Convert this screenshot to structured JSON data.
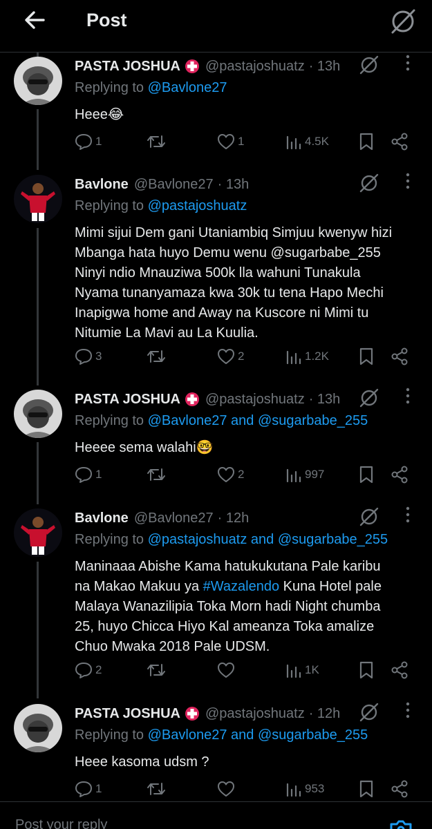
{
  "header": {
    "title": "Post"
  },
  "replies": [
    {
      "name": "PASTA JOSHUA",
      "handle": "@pastajoshuatz",
      "time": "· 13h",
      "replying_prefix": "Replying to ",
      "mentions": [
        "@Bavlone27"
      ],
      "text": "Heee😂",
      "stats": {
        "replies": "1",
        "reposts": "",
        "likes": "1",
        "views": "4.5K"
      }
    },
    {
      "name": "Bavlone",
      "handle": "@Bavlone27",
      "time": "· 13h",
      "replying_prefix": "Replying to ",
      "mentions": [
        "@pastajoshuatz"
      ],
      "text": "Mimi sijui Dem gani Utaniambiq Simjuu kwenyw hizi\nMbanga hata huyo Demu wenu @sugarbabe_255\nNinyi ndio Mnauziwa 500k lla wahuni Tunakula\nNyama tunanyamaza kwa 30k tu tena Hapo Mechi\nInapigwa home and Away na Kuscore ni Mimi tu\nNitumie La Mavi au La Kuulia.",
      "stats": {
        "replies": "3",
        "reposts": "",
        "likes": "2",
        "views": "1.2K"
      }
    },
    {
      "name": "PASTA JOSHUA",
      "handle": "@pastajoshuatz",
      "time": "· 13h",
      "replying_prefix": "Replying to ",
      "mentions": [
        "@Bavlone27",
        "@sugarbabe_255"
      ],
      "conj": " and ",
      "text": "Heeee sema walahi🤓",
      "stats": {
        "replies": "1",
        "reposts": "",
        "likes": "2",
        "views": "997"
      }
    },
    {
      "name": "Bavlone",
      "handle": "@Bavlone27",
      "time": "· 12h",
      "replying_prefix": "Replying to ",
      "mentions": [
        "@pastajoshuatz",
        "@sugarbabe_255"
      ],
      "conj": " and ",
      "text_parts": [
        "Maninaaa Abishe Kama hatukukutana Pale karibu\nna Makao Makuu ya ",
        "#Wazalendo",
        " Kuna Hotel pale\nMalaya Wanazilipia Toka Morn hadi Night chumba\n25, huyo Chicca Hiyo Kal ameanza Toka amalize\nChuo Mwaka 2018 Pale UDSM."
      ],
      "stats": {
        "replies": "2",
        "reposts": "",
        "likes": "",
        "views": "1K"
      }
    },
    {
      "name": "PASTA JOSHUA",
      "handle": "@pastajoshuatz",
      "time": "· 12h",
      "replying_prefix": "Replying to ",
      "mentions": [
        "@Bavlone27",
        "@sugarbabe_255"
      ],
      "conj": " and ",
      "text": "Heee kasoma udsm ?",
      "stats": {
        "replies": "1",
        "reposts": "",
        "likes": "",
        "views": "953"
      }
    }
  ],
  "composer": {
    "placeholder": "Post your reply"
  },
  "colors": {
    "accent": "#1d9bf0",
    "muted": "#71767b",
    "text": "#e7e9ea",
    "background": "#000000",
    "badge": "#e0245e"
  }
}
